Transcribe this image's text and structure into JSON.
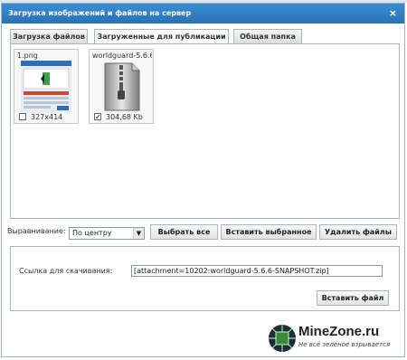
{
  "dialog": {
    "title": "Загрузка изображений и файлов на сервер",
    "close_label": "×"
  },
  "tabs": [
    {
      "label": "Загрузка файлов"
    },
    {
      "label": "Загруженные для публикации"
    },
    {
      "label": "Общая папка"
    }
  ],
  "files": [
    {
      "name": "1.png",
      "meta": "327x414",
      "checked": false
    },
    {
      "name": "worldguard-5.6.6-",
      "meta": "304,68 Kb",
      "checked": true
    }
  ],
  "alignment": {
    "label": "Выравнивание:",
    "value": "По центру"
  },
  "buttons": {
    "select_all": "Выбрать все",
    "insert_selected": "Вставить выбранное",
    "delete_files": "Удалить файлы",
    "insert_file": "Вставить файл"
  },
  "download": {
    "label": "Ссылка для скачивания:",
    "value": "[attachment=10202:worldguard-5.6.6-SNAPSHOT.zip]"
  },
  "watermark": {
    "title": "MineZone.ru",
    "subtitle": "Не всё зелёное взрывается"
  }
}
